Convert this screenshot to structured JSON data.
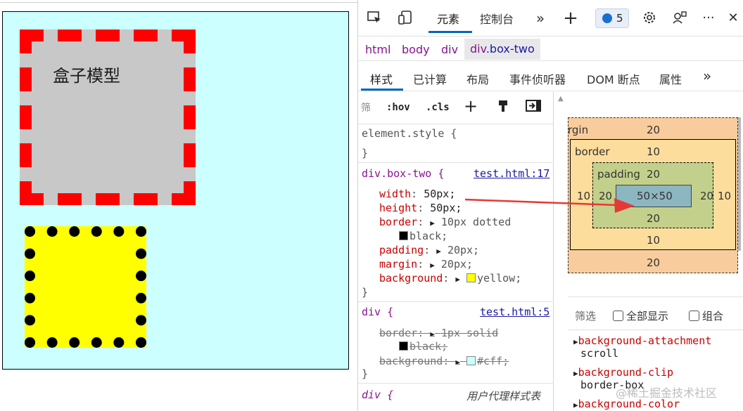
{
  "demo": {
    "box_one_text": "盒子模型",
    "box_one_border_color": "#ff0000",
    "box_one_background": "#c8c8c8",
    "box_two_background": "#ffff00",
    "page_background": "#ccffff"
  },
  "toolbar": {
    "tabs": [
      "元素",
      "控制台"
    ],
    "more": "»",
    "add": "+",
    "issues_count": "5",
    "ellipsis": "···",
    "close": "✕"
  },
  "breadcrumb": {
    "items": [
      "html",
      "body",
      "div"
    ],
    "selected_tag": "div",
    "selected_class": ".box-two"
  },
  "subtabs": [
    "样式",
    "已计算",
    "布局",
    "事件侦听器",
    "DOM 断点",
    "属性"
  ],
  "subtabs_more": "»",
  "styles": {
    "filter_placeholder": "筛",
    "hov": ":hov",
    "cls": ".cls",
    "element_style": "element.style {",
    "close_brace": "}",
    "rule1": {
      "selector": "div.box-two {",
      "link": "test.html:17",
      "width_prop": "width",
      "width_val": "50px;",
      "height_prop": "height",
      "height_val": "50px;",
      "border_prop": "border",
      "border_val": "10px dotted",
      "border_color": "black;",
      "padding_prop": "padding",
      "padding_val": "20px;",
      "margin_prop": "margin",
      "margin_val": "20px;",
      "background_prop": "background",
      "background_val": "yellow;"
    },
    "rule2": {
      "selector": "div {",
      "link": "test.html:5",
      "border_prop": "border",
      "border_val": "1px solid",
      "border_color": "black;",
      "background_prop": "background",
      "background_val": "#cff;"
    },
    "rule3": {
      "selector": "div {",
      "source": "用户代理样式表"
    }
  },
  "box_model": {
    "margin_label": "margin",
    "margin_visible": "rgin",
    "margin_top": "20",
    "margin_bottom": "20",
    "border_label": "border",
    "border_top": "10",
    "border_bottom": "10",
    "border_left": "10",
    "border_right": "10",
    "padding_label": "padding",
    "padding_top": "20",
    "padding_bottom": "20",
    "padding_left": "20",
    "padding_right": "20",
    "content": "50×50"
  },
  "computed": {
    "filter_label": "筛选",
    "show_all": "全部显示",
    "group": "组合",
    "items": [
      {
        "prop": "background-attachment",
        "value": "scroll"
      },
      {
        "prop": "background-clip",
        "value": "border-box"
      },
      {
        "prop": "background-color",
        "value": ""
      }
    ]
  },
  "watermark": "@稀土掘金技术社区",
  "colors": {
    "accent": "#0067c0",
    "arrow": "#e53935",
    "selector": "#881391",
    "property": "#c80000"
  }
}
